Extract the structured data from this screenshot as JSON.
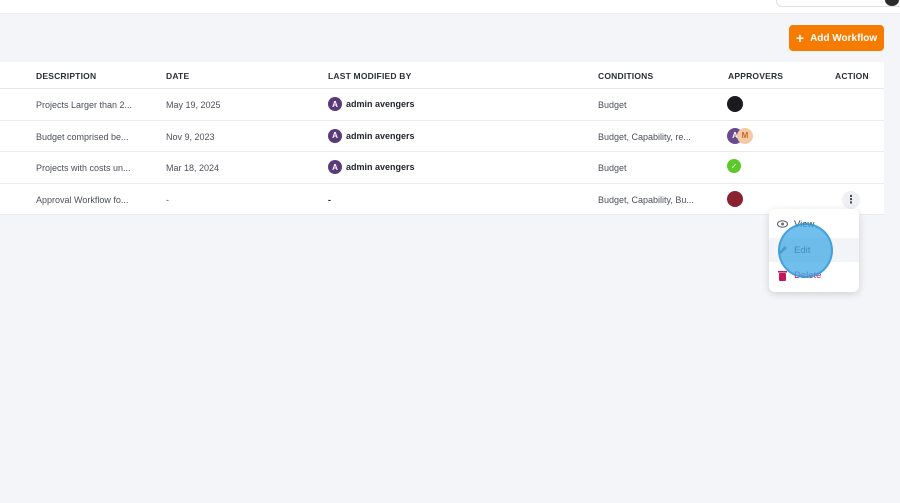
{
  "header": {
    "add_button_label": "Add Workflow",
    "add_button_icon": "plus-icon",
    "accent_color": "#f57c00"
  },
  "table": {
    "columns": {
      "description": "DESCRIPTION",
      "date": "DATE",
      "last_modified_by": "LAST MODIFIED BY",
      "conditions": "CONDITIONS",
      "approvers": "APPROVERS",
      "action": "ACTION"
    },
    "rows": [
      {
        "description": "Projects Larger than 2...",
        "date": "May 19, 2025",
        "modified_by": "admin avengers",
        "conditions": "Budget",
        "approvers": [
          "dark-avatar"
        ]
      },
      {
        "description": "Budget comprised be...",
        "date": "Nov 9, 2023",
        "modified_by": "admin avengers",
        "conditions": "Budget, Capability, re...",
        "approvers": [
          "purple-avatar",
          "peach-avatar"
        ],
        "approver_initial": "M"
      },
      {
        "description": "Projects with costs un...",
        "date": "Mar 18, 2024",
        "modified_by": "admin avengers",
        "conditions": "Budget",
        "approvers": [
          "check-avatar"
        ]
      },
      {
        "description": "Approval Workflow fo...",
        "date": "-",
        "modified_by": "-",
        "conditions": "Budget, Capability, Bu...",
        "approvers": [
          "red-avatar"
        ]
      }
    ]
  },
  "action_menu": {
    "view_label": "View",
    "edit_label": "Edit",
    "delete_label": "Delete",
    "delete_color": "#c2185b"
  }
}
